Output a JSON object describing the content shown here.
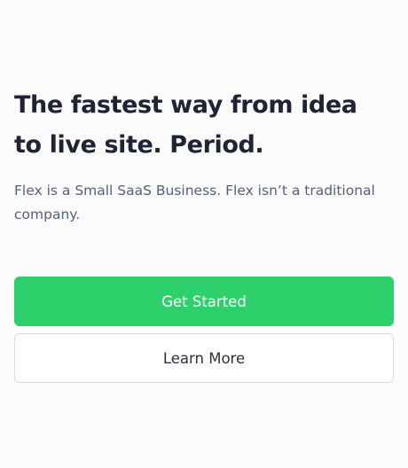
{
  "hero": {
    "headline": "The fastest way from idea to live site. Period.",
    "subtext": "Flex is a Small SaaS Business. Flex isn’t a traditional company.",
    "primary_button": "Get Started",
    "secondary_button": "Learn More"
  },
  "colors": {
    "background": "#fbfbfc",
    "headline": "#1e2433",
    "subtext": "#556079",
    "primary_accent": "#2dd06a",
    "secondary_border": "#d9dde3"
  }
}
